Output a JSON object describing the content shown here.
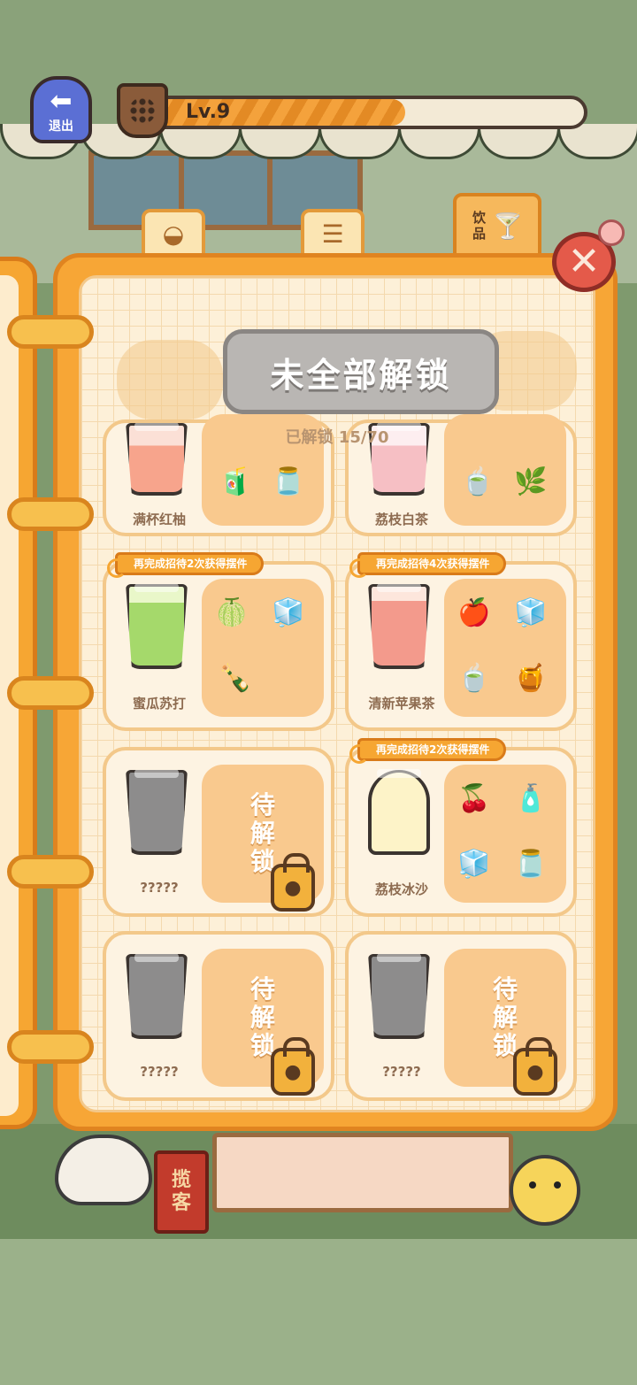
{
  "hud": {
    "exit_label": "退出",
    "level_label": "Lv.9",
    "level_progress": 0.6
  },
  "tabs": {
    "drinks_label": "饮品"
  },
  "book": {
    "header_title": "未全部解锁",
    "unlocked_label": "已解锁",
    "unlocked_count": "15/70"
  },
  "cards": [
    {
      "name": "满杯红柚",
      "state": "unlocked",
      "banner": ""
    },
    {
      "name": "荔枝白茶",
      "state": "unlocked",
      "banner": ""
    },
    {
      "name": "蜜瓜苏打",
      "state": "unlocked",
      "banner": "再完成招待2次获得摆件"
    },
    {
      "name": "清新苹果茶",
      "state": "unlocked",
      "banner": "再完成招待4次获得摆件"
    },
    {
      "name": "?????",
      "state": "locked",
      "locked_text": "待解锁"
    },
    {
      "name": "荔枝冰沙",
      "state": "unlocked",
      "banner": "再完成招待2次获得摆件"
    },
    {
      "name": "?????",
      "state": "locked",
      "locked_text": "待解锁"
    },
    {
      "name": "?????",
      "state": "locked",
      "locked_text": "待解锁"
    }
  ],
  "background": {
    "lanyard_label": "揽客"
  },
  "colors": {
    "accent_orange": "#f6a632",
    "paper": "#fdf0d8",
    "locked_gray": "#8d8c8c",
    "close_red": "#e45a4a"
  }
}
